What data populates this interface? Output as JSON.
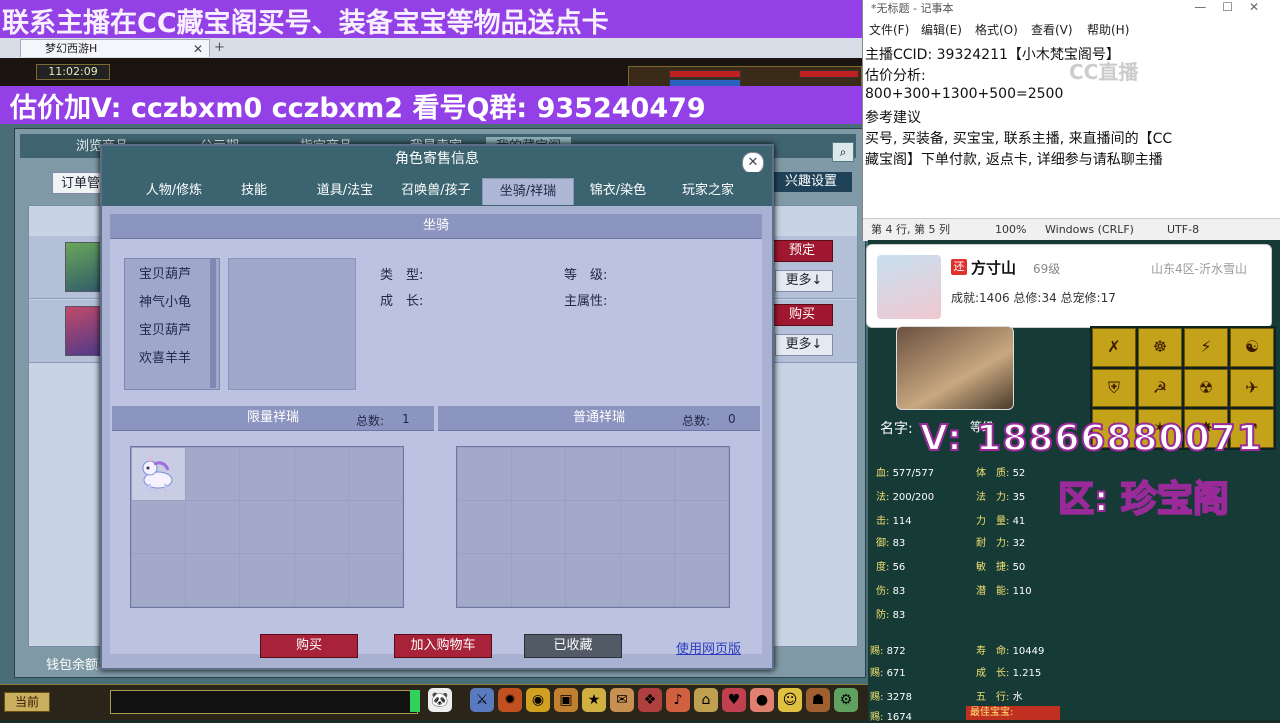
{
  "overlays": {
    "top_banner": "联系主播在CC藏宝阁买号、装备宝宝等物品送点卡",
    "price_banner": "估价加V:   cczbxm0   cczbxm2   看号Q群: 935240479",
    "v_contact": "V: 18866880071",
    "zone": "区: 珍宝阁",
    "colors": {
      "banner": "#9340e6",
      "stroke": "#9a2a9a"
    }
  },
  "browser": {
    "tab_title": "梦幻西游H"
  },
  "game": {
    "clock": "11:02:09",
    "shop_tabs": [
      "浏览商品",
      "公示期",
      "指定商品",
      "我是卖家",
      "我的藏宝阁"
    ],
    "order_button": "订单管",
    "settings_button": "兴趣设置",
    "rows": [
      {
        "primary": "预定",
        "more": "更多↓"
      },
      {
        "primary": "购买",
        "more": "更多↓"
      }
    ],
    "wallet": "钱包余额:",
    "bottom_bar": {
      "current": "当前"
    }
  },
  "dialog": {
    "title": "角色寄售信息",
    "tabs": [
      "人物/修炼",
      "技能",
      "道具/法宝",
      "召唤兽/孩子",
      "坐骑/祥瑞",
      "锦衣/染色",
      "玩家之家"
    ],
    "active_tab_index": 4,
    "mount_section": "坐骑",
    "mounts": [
      "宝贝葫芦",
      "神气小龟",
      "宝贝葫芦",
      "欢喜羊羊"
    ],
    "labels": {
      "type": "类　型:",
      "level": "等　级:",
      "growth": "成　长:",
      "main_attr": "主属性:"
    },
    "limited": {
      "title": "限量祥瑞",
      "total_label": "总数:",
      "total": "1"
    },
    "normal": {
      "title": "普通祥瑞",
      "total_label": "总数:",
      "total": "0"
    },
    "buttons": {
      "buy": "购买",
      "add_cart": "加入购物车",
      "favorited": "已收藏",
      "web": "使用网页版"
    }
  },
  "notepad": {
    "title": "*无标题 - 记事本",
    "menu": [
      "文件(F)",
      "编辑(E)",
      "格式(O)",
      "查看(V)",
      "帮助(H)"
    ],
    "lines": [
      "主播CCID: 39324211【小木梵宝阁号】",
      "估价分析:",
      "800+300+1300+500=2500",
      "参考建议",
      "买号, 买装备, 买宝宝, 联系主播, 来直播间的【CC",
      "藏宝阁】下单付款, 返点卡, 详细参与请私聊主播"
    ],
    "watermark": "CC直播",
    "status": [
      "第 4 行, 第 5 列",
      "100%",
      "Windows (CRLF)",
      "UTF-8"
    ]
  },
  "character_card": {
    "tag": "还",
    "name": "方寸山",
    "level": "69级",
    "server": "山东4区-沂水雪山",
    "stats": "成就:1406 总修:34 总宠修:17"
  },
  "pet_stats": {
    "name_label": "名字:",
    "name_rest": "等级",
    "rows": [
      [
        "血:",
        "577/577",
        "体　质:",
        "52"
      ],
      [
        "法:",
        "200/200",
        "法　力:",
        "35"
      ],
      [
        "击:",
        "114",
        "力　量:",
        "41"
      ],
      [
        "御:",
        "83",
        "耐　力:",
        "32"
      ],
      [
        "度:",
        "56",
        "敏　捷:",
        "50"
      ],
      [
        "伤:",
        "83",
        "潜　能:",
        "110"
      ],
      [
        "防:",
        "83",
        "",
        ""
      ]
    ],
    "rows2": [
      [
        "赐:",
        "872",
        "寿　命:",
        "10449"
      ],
      [
        "赐:",
        "671",
        "成　长:",
        "1.215"
      ],
      [
        "赐:",
        "3278",
        "五　行:",
        "水"
      ],
      [
        "赐:",
        "1674",
        "",
        ""
      ]
    ],
    "treasure": "最佳宝宝:"
  }
}
